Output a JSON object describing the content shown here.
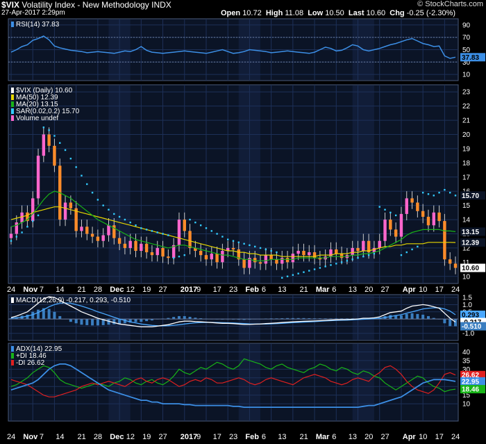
{
  "header": {
    "symbol": "$VIX",
    "name": "Volatility Index - New Methodology",
    "exchange": "INDX",
    "date": "27-Apr-2017 2:29pm",
    "watermark": "© StockCharts.com",
    "open_label": "Open",
    "open": "10.72",
    "high_label": "High",
    "high": "11.08",
    "low_label": "Low",
    "low": "10.50",
    "last_label": "Last",
    "last": "10.60",
    "chg_label": "Chg",
    "chg": "-0.25 (-2.30%)"
  },
  "colors": {
    "background": "#000000",
    "panel_bg": "#0b1426",
    "band_bg": "#111d38",
    "grid": "#1d3058",
    "up_candle": "#ff66cc",
    "down_candle": "#ff8c2a",
    "ma50": "#e6d600",
    "ma20": "#18b418",
    "sar": "#33ccff",
    "rsi": "#3c8fe6",
    "macd": "#ffffff",
    "signal": "#4aa8ff",
    "hist": "#3a7ec0",
    "adx": "#3c8fe6",
    "pdi": "#18b418",
    "mdi": "#e02020"
  },
  "chart_data": [
    {
      "type": "line",
      "title": "RSI(14) 37.83",
      "legend": [
        "RSI(14) 37.83"
      ],
      "ylim": [
        0,
        100
      ],
      "ticks": [
        10,
        30,
        50,
        70,
        90
      ],
      "reference_lines": [
        30,
        70
      ],
      "last_label": "37.83",
      "series": [
        {
          "name": "RSI(14)",
          "values": [
            46,
            50,
            55,
            58,
            65,
            68,
            72,
            66,
            56,
            53,
            51,
            49,
            48,
            47,
            45,
            46,
            47,
            46,
            45,
            44,
            46,
            48,
            47,
            50,
            55,
            49,
            46,
            45,
            44,
            45,
            46,
            47,
            48,
            47,
            46,
            45,
            44,
            46,
            48,
            50,
            47,
            44,
            45,
            47,
            50,
            49,
            48,
            47,
            45,
            46,
            47,
            48,
            47,
            46,
            45,
            44,
            46,
            50,
            54,
            52,
            48,
            49,
            53,
            58,
            56,
            50,
            48,
            50,
            52,
            55,
            58,
            60,
            63,
            66,
            68,
            64,
            60,
            58,
            55,
            56,
            40,
            36,
            37.83
          ]
        }
      ]
    },
    {
      "type": "candlestick",
      "legend": [
        "$VIX (Daily) 10.60",
        "MA(50) 12.39",
        "MA(20) 13.15",
        "SAR(0.02,0.2) 15.70",
        "Volume undef"
      ],
      "ylim": [
        9.5,
        23.5
      ],
      "ticks": [
        10,
        11,
        12,
        13,
        14,
        15,
        16,
        17,
        18,
        19,
        20,
        21,
        22,
        23
      ],
      "x_labels": [
        "24",
        "Nov",
        "7",
        "14",
        "21",
        "28",
        "Dec",
        "12",
        "19",
        "27",
        "2017",
        "9",
        "17",
        "23",
        "Feb",
        "6",
        "13",
        "21",
        "Mar",
        "6",
        "13",
        "20",
        "27",
        "Apr",
        "10",
        "17",
        "24"
      ],
      "value_labels": [
        "15.70",
        "13.15",
        "12.39",
        "10.60"
      ],
      "ohlc_close": [
        13.0,
        13.8,
        14.5,
        13.9,
        15.5,
        18.5,
        20.0,
        19.2,
        17.8,
        14.0,
        15.2,
        14.8,
        13.2,
        13.5,
        13.0,
        12.8,
        12.5,
        12.9,
        13.6,
        12.7,
        12.3,
        12.0,
        12.5,
        11.8,
        12.3,
        11.7,
        11.5,
        12.0,
        11.4,
        11.3,
        12.2,
        14.0,
        13.2,
        12.0,
        11.8,
        11.5,
        11.2,
        11.6,
        11.0,
        11.8,
        12.0,
        11.9,
        11.2,
        10.6,
        11.3,
        11.0,
        10.9,
        11.5,
        11.2,
        10.9,
        11.3,
        11.0,
        11.6,
        11.8,
        11.5,
        11.7,
        11.3,
        11.2,
        11.4,
        11.9,
        11.6,
        11.3,
        11.5,
        12.0,
        11.8,
        12.5,
        11.7,
        12.0,
        12.5,
        14.0,
        13.3,
        12.8,
        14.4,
        15.5,
        15.2,
        14.6,
        14.2,
        13.6,
        14.5,
        13.9,
        11.2,
        10.9,
        10.6
      ],
      "series": [
        {
          "name": "MA(50) 12.39",
          "values": [
            14.0,
            14.1,
            14.2,
            14.3,
            14.5,
            14.6,
            14.7,
            14.8,
            14.9,
            14.9,
            14.8,
            14.7,
            14.6,
            14.5,
            14.4,
            14.3,
            14.2,
            14.1,
            14.0,
            13.9,
            13.8,
            13.7,
            13.6,
            13.5,
            13.4,
            13.3,
            13.2,
            13.1,
            13.0,
            12.9,
            12.8,
            12.7,
            12.6,
            12.5,
            12.4,
            12.3,
            12.2,
            12.1,
            12.0,
            11.9,
            11.8,
            11.8,
            11.7,
            11.7,
            11.6,
            11.6,
            11.5,
            11.5,
            11.5,
            11.5,
            11.4,
            11.4,
            11.4,
            11.4,
            11.4,
            11.4,
            11.4,
            11.5,
            11.5,
            11.5,
            11.6,
            11.6,
            11.6,
            11.7,
            11.7,
            11.8,
            11.8,
            11.9,
            12.0,
            12.1,
            12.1,
            12.2,
            12.2,
            12.3,
            12.3,
            12.3,
            12.3,
            12.4,
            12.4,
            12.4,
            12.4,
            12.4,
            12.39
          ]
        },
        {
          "name": "MA(20) 13.15",
          "values": [
            13.5,
            13.6,
            13.8,
            14.0,
            14.4,
            14.9,
            15.4,
            15.8,
            16.0,
            15.9,
            15.7,
            15.5,
            15.2,
            14.9,
            14.6,
            14.3,
            14.0,
            13.8,
            13.6,
            13.4,
            13.2,
            13.0,
            12.8,
            12.6,
            12.5,
            12.4,
            12.3,
            12.2,
            12.1,
            12.0,
            12.1,
            12.2,
            12.2,
            12.1,
            12.0,
            11.9,
            11.8,
            11.7,
            11.6,
            11.5,
            11.5,
            11.4,
            11.3,
            11.2,
            11.2,
            11.1,
            11.1,
            11.1,
            11.2,
            11.2,
            11.2,
            11.2,
            11.2,
            11.3,
            11.3,
            11.3,
            11.3,
            11.3,
            11.3,
            11.4,
            11.4,
            11.4,
            11.4,
            11.5,
            11.5,
            11.6,
            11.6,
            11.7,
            11.8,
            12.0,
            12.2,
            12.4,
            12.6,
            12.9,
            13.1,
            13.2,
            13.3,
            13.3,
            13.3,
            13.3,
            13.2,
            13.2,
            13.15
          ]
        },
        {
          "name": "SAR(0.02,0.2) 15.70",
          "values": [
            12.5,
            12.8,
            13.1,
            13.5,
            13.9,
            14.3,
            20.5,
            20.3,
            19.9,
            19.4,
            18.9,
            18.3,
            17.7,
            17.1,
            16.5,
            15.9,
            15.4,
            15.0,
            14.7,
            14.4,
            14.2,
            14.0,
            13.8,
            13.6,
            13.4,
            13.3,
            13.2,
            13.1,
            13.0,
            12.9,
            11.3,
            11.4,
            11.5,
            14.0,
            13.8,
            13.6,
            13.4,
            13.2,
            13.0,
            12.8,
            12.6,
            12.5,
            12.4,
            12.3,
            12.2,
            12.1,
            12.0,
            11.9,
            11.8,
            11.7,
            9.9,
            10.0,
            10.1,
            10.2,
            10.3,
            10.4,
            10.5,
            10.6,
            10.7,
            10.8,
            10.9,
            11.0,
            11.1,
            11.2,
            11.3,
            11.4,
            11.5,
            11.6,
            14.9,
            14.7,
            14.5,
            14.3,
            11.5,
            11.7,
            11.9,
            12.1,
            15.9,
            15.8,
            15.7,
            15.9,
            16.1,
            15.9,
            15.7
          ]
        }
      ]
    },
    {
      "type": "line",
      "title": "MACD(12,26,9) -0.217, 0.293, -0.510",
      "legend": [
        "MACD(12,26,9) -0.217, 0.293, -0.510"
      ],
      "ylim": [
        -1.5,
        1.7
      ],
      "ticks": [
        -1.0,
        -0.5,
        0.0,
        0.5,
        1.0,
        1.5
      ],
      "value_labels": [
        "0.293",
        "-0.217",
        "-0.510"
      ],
      "series": [
        {
          "name": "MACD",
          "values": [
            0.1,
            0.2,
            0.35,
            0.5,
            0.8,
            1.1,
            1.4,
            1.55,
            1.5,
            1.3,
            1.1,
            0.9,
            0.7,
            0.5,
            0.35,
            0.2,
            0.05,
            -0.05,
            -0.15,
            -0.25,
            -0.35,
            -0.4,
            -0.45,
            -0.5,
            -0.55,
            -0.55,
            -0.55,
            -0.5,
            -0.45,
            -0.4,
            -0.3,
            -0.2,
            -0.15,
            -0.15,
            -0.18,
            -0.2,
            -0.22,
            -0.25,
            -0.28,
            -0.3,
            -0.3,
            -0.32,
            -0.35,
            -0.38,
            -0.38,
            -0.36,
            -0.35,
            -0.32,
            -0.3,
            -0.28,
            -0.25,
            -0.22,
            -0.2,
            -0.18,
            -0.16,
            -0.15,
            -0.14,
            -0.12,
            -0.1,
            -0.08,
            -0.06,
            -0.05,
            -0.04,
            -0.02,
            0.0,
            0.05,
            0.05,
            0.08,
            0.15,
            0.3,
            0.45,
            0.5,
            0.55,
            0.75,
            0.9,
            0.95,
            1.0,
            0.95,
            0.85,
            0.75,
            0.4,
            0.05,
            -0.217
          ]
        },
        {
          "name": "Signal",
          "values": [
            0.05,
            0.08,
            0.12,
            0.2,
            0.3,
            0.45,
            0.65,
            0.85,
            1.0,
            1.1,
            1.12,
            1.1,
            1.0,
            0.9,
            0.78,
            0.65,
            0.5,
            0.38,
            0.25,
            0.12,
            0.0,
            -0.1,
            -0.2,
            -0.28,
            -0.35,
            -0.4,
            -0.45,
            -0.47,
            -0.48,
            -0.47,
            -0.44,
            -0.4,
            -0.35,
            -0.3,
            -0.27,
            -0.25,
            -0.24,
            -0.24,
            -0.25,
            -0.26,
            -0.27,
            -0.28,
            -0.3,
            -0.32,
            -0.34,
            -0.35,
            -0.35,
            -0.35,
            -0.34,
            -0.32,
            -0.3,
            -0.28,
            -0.26,
            -0.24,
            -0.22,
            -0.2,
            -0.18,
            -0.16,
            -0.14,
            -0.12,
            -0.1,
            -0.09,
            -0.08,
            -0.06,
            -0.04,
            -0.02,
            0.0,
            0.02,
            0.05,
            0.1,
            0.17,
            0.24,
            0.3,
            0.4,
            0.5,
            0.6,
            0.7,
            0.75,
            0.78,
            0.78,
            0.7,
            0.55,
            0.293
          ]
        }
      ]
    },
    {
      "type": "line",
      "title": "ADX(14) 22.95 +DI 18.46 -DI 26.62",
      "legend": [
        "ADX(14) 22.95",
        "+DI 18.46",
        "-DI 26.62"
      ],
      "ylim": [
        0,
        45
      ],
      "ticks": [
        10,
        15,
        20,
        25,
        30,
        35,
        40
      ],
      "value_labels": [
        "26.62",
        "22.95",
        "18.46"
      ],
      "series": [
        {
          "name": "ADX(14) 22.95",
          "values": [
            18,
            19,
            20,
            21,
            22,
            24,
            27,
            30,
            32,
            33,
            33,
            32,
            30,
            28,
            26,
            24,
            22,
            20,
            18,
            17,
            16,
            15,
            14,
            13,
            12,
            12,
            11,
            11,
            10,
            10,
            10,
            10,
            9.5,
            9.5,
            9,
            9,
            9,
            9,
            9,
            9,
            9,
            8.5,
            8.5,
            8,
            8,
            8,
            8,
            8,
            8,
            8,
            8,
            8,
            8,
            8,
            8,
            8,
            8,
            8,
            8,
            8,
            8,
            8,
            8,
            8,
            8,
            8.5,
            9,
            9,
            10,
            11,
            12,
            13,
            14,
            16,
            18,
            20,
            22,
            23,
            24,
            24,
            24,
            23.5,
            22.95
          ]
        },
        {
          "name": "+DI 18.46",
          "values": [
            20,
            21,
            23,
            25,
            28,
            30,
            32,
            31,
            28,
            24,
            22,
            21,
            20,
            19,
            20,
            21,
            22,
            21,
            20,
            22,
            23,
            25,
            24,
            22,
            21,
            23,
            24,
            22,
            21,
            23,
            26,
            30,
            28,
            27,
            29,
            31,
            30,
            32,
            34,
            33,
            31,
            30,
            32,
            36,
            35,
            34,
            33,
            31,
            30,
            32,
            33,
            31,
            30,
            29,
            28,
            30,
            31,
            33,
            32,
            30,
            29,
            31,
            30,
            28,
            27,
            29,
            28,
            26,
            25,
            22,
            20,
            18,
            20,
            22,
            24,
            26,
            25,
            22,
            20,
            19,
            17,
            18,
            18.46
          ]
        },
        {
          "name": "-DI 26.62",
          "values": [
            24,
            23,
            22,
            21,
            19,
            17,
            15,
            14,
            14,
            15,
            16,
            17,
            18,
            20,
            21,
            22,
            21,
            22,
            23,
            22,
            21,
            20,
            22,
            24,
            25,
            23,
            22,
            24,
            25,
            24,
            22,
            20,
            21,
            23,
            24,
            23,
            25,
            24,
            22,
            22,
            23,
            24,
            25,
            24,
            22,
            21,
            22,
            24,
            25,
            24,
            23,
            22,
            21,
            23,
            25,
            26,
            27,
            26,
            25,
            23,
            22,
            21,
            22,
            24,
            25,
            24,
            23,
            26,
            28,
            31,
            32,
            30,
            27,
            23,
            20,
            18,
            17,
            16,
            18,
            22,
            27,
            28,
            26.62
          ]
        }
      ]
    }
  ]
}
